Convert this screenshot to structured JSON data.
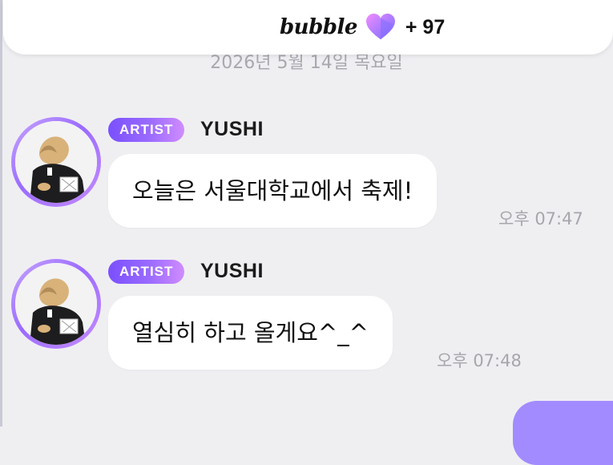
{
  "header": {
    "brand": "bubble",
    "count": "+ 97",
    "heart_icon": "heart-icon"
  },
  "date_separator": "2026년 5월 14일 목요일",
  "messages": [
    {
      "badge": "ARTIST",
      "sender": "YUSHI",
      "text": "오늘은 서울대학교에서 축제!",
      "time": "오후 07:47"
    },
    {
      "badge": "ARTIST",
      "sender": "YUSHI",
      "text": "열심히 하고 올게요^_^",
      "time": "오후 07:48"
    }
  ],
  "colors": {
    "background": "#efeff2",
    "accent_purple": "#9b6bff",
    "bubble": "#ffffff",
    "timestamp": "#a6a6ac"
  }
}
